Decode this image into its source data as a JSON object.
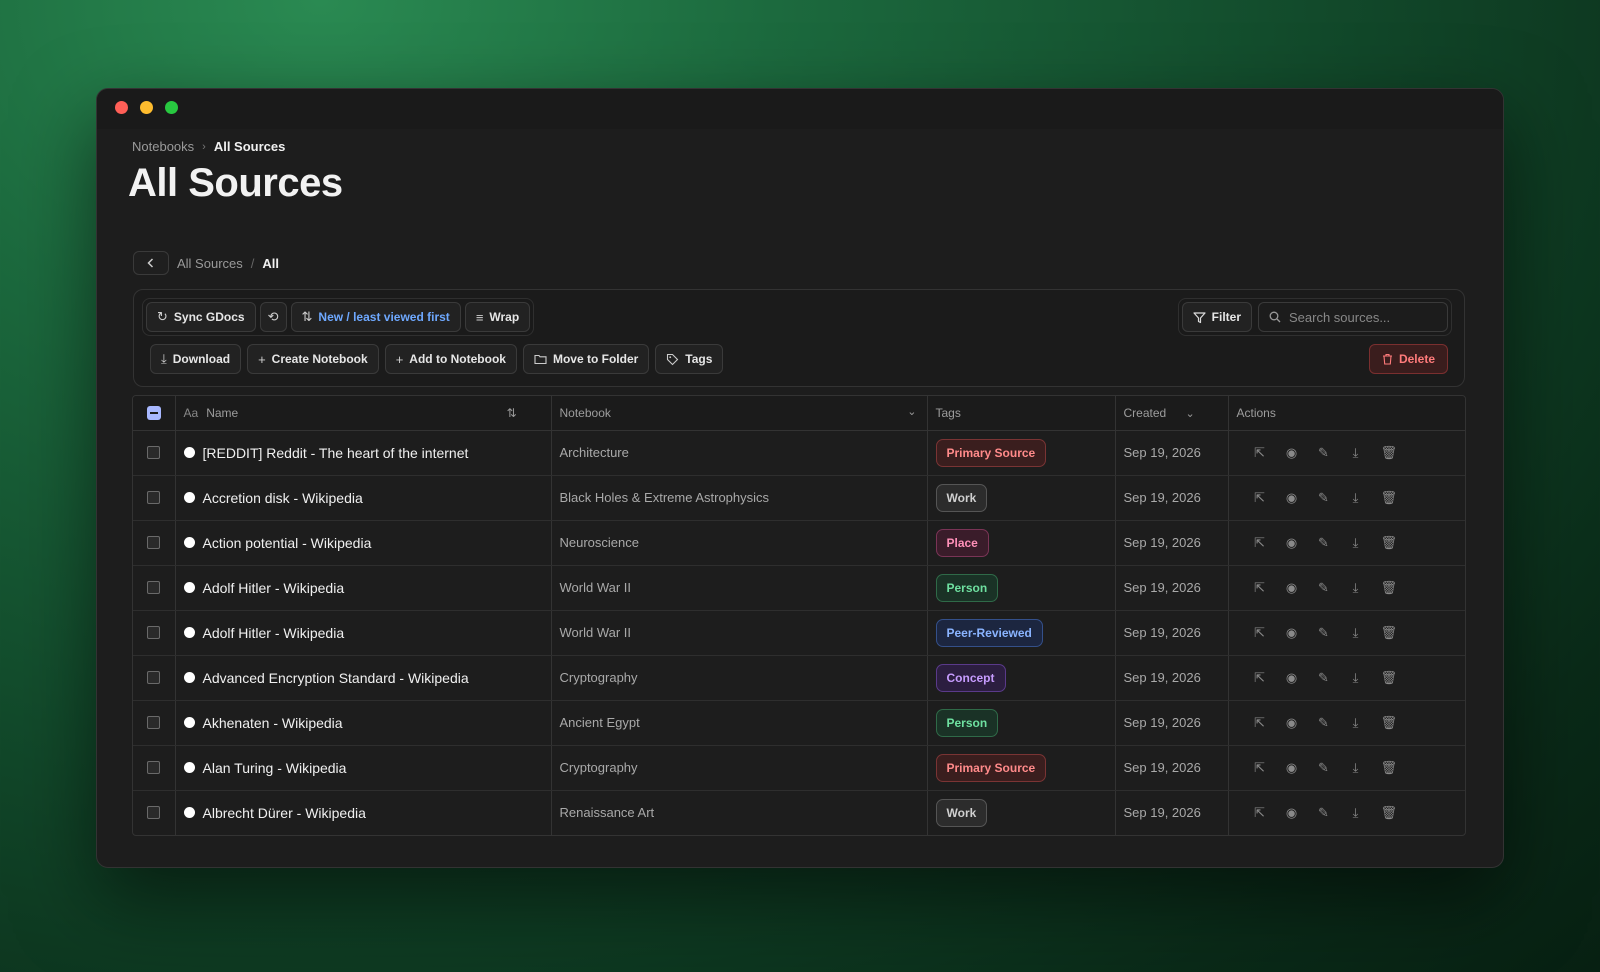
{
  "breadcrumb": {
    "root": "Notebooks",
    "current": "All Sources"
  },
  "page_title": "All Sources",
  "sub_breadcrumb": {
    "parent": "All Sources",
    "separator": "/",
    "current": "All"
  },
  "toolbar": {
    "sync_label": "Sync GDocs",
    "sort_label": "New / least viewed first",
    "wrap_label": "Wrap",
    "filter_label": "Filter",
    "search_placeholder": "Search sources...",
    "download_label": "Download",
    "create_notebook_label": "Create Notebook",
    "add_to_notebook_label": "Add to Notebook",
    "move_to_folder_label": "Move to Folder",
    "tags_label": "Tags",
    "delete_label": "Delete"
  },
  "table": {
    "headers": {
      "name_prefix": "Aa",
      "name": "Name",
      "notebook": "Notebook",
      "tags": "Tags",
      "created": "Created",
      "actions": "Actions"
    },
    "tag_colors": {
      "Primary Source": {
        "fg": "#ff8a8a",
        "bg": "#3a1e1e",
        "border": "#7a3434"
      },
      "Work": {
        "fg": "#d0d0d0",
        "bg": "#2c2c2c",
        "border": "#555555"
      },
      "Place": {
        "fg": "#ff8fb8",
        "bg": "#3a1c2a",
        "border": "#7a3456"
      },
      "Person": {
        "fg": "#6ee0a0",
        "bg": "#1a3226",
        "border": "#2f6a48"
      },
      "Peer-Reviewed": {
        "fg": "#8ab4ff",
        "bg": "#1c2640",
        "border": "#34508a"
      },
      "Concept": {
        "fg": "#c79cff",
        "bg": "#2c1e40",
        "border": "#5a3a8a"
      }
    },
    "rows": [
      {
        "name": "[REDDIT] Reddit - The heart of the internet",
        "notebook": "Architecture",
        "tag": "Primary Source",
        "created": "Sep 19, 2026"
      },
      {
        "name": "Accretion disk - Wikipedia",
        "notebook": "Black Holes & Extreme Astrophysics",
        "tag": "Work",
        "created": "Sep 19, 2026"
      },
      {
        "name": "Action potential - Wikipedia",
        "notebook": "Neuroscience",
        "tag": "Place",
        "created": "Sep 19, 2026"
      },
      {
        "name": "Adolf Hitler - Wikipedia",
        "notebook": "World War II",
        "tag": "Person",
        "created": "Sep 19, 2026"
      },
      {
        "name": "Adolf Hitler - Wikipedia",
        "notebook": "World War II",
        "tag": "Peer-Reviewed",
        "created": "Sep 19, 2026"
      },
      {
        "name": "Advanced Encryption Standard - Wikipedia",
        "notebook": "Cryptography",
        "tag": "Concept",
        "created": "Sep 19, 2026"
      },
      {
        "name": "Akhenaten - Wikipedia",
        "notebook": "Ancient Egypt",
        "tag": "Person",
        "created": "Sep 19, 2026"
      },
      {
        "name": "Alan Turing - Wikipedia",
        "notebook": "Cryptography",
        "tag": "Primary Source",
        "created": "Sep 19, 2026"
      },
      {
        "name": "Albrecht Dürer - Wikipedia",
        "notebook": "Renaissance Art",
        "tag": "Work",
        "created": "Sep 19, 2026"
      }
    ]
  }
}
